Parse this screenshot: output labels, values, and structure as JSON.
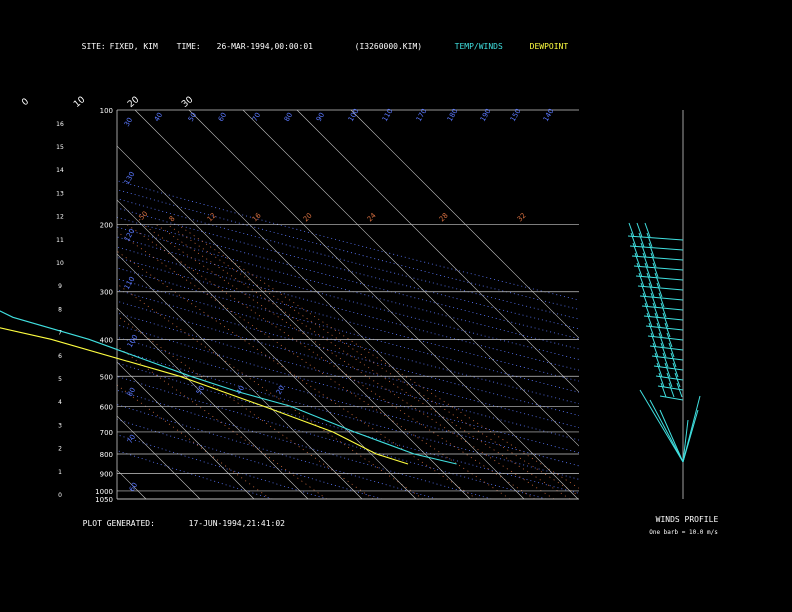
{
  "header": {
    "site_label": "SITE:",
    "site_value": "FIXED, KIM",
    "time_label": "TIME:",
    "time_value": "26-MAR-1994,00:00:01",
    "file_id": "(I3260000.KIM)",
    "temp_legend": "TEMP/WINDS",
    "dew_legend": "DEWPOINT"
  },
  "footer": {
    "generated_label": "PLOT GENERATED:",
    "generated_value": "17-JUN-1994,21:41:02",
    "winds_title": "WINDS PROFILE",
    "barb_note": "One barb = 10.0 m/s"
  },
  "colors": {
    "temperature": "#40e0e0",
    "dewpoint": "#ffff40",
    "isotherm": "#c8c8c8",
    "dry_adiabat": "#5a78ff",
    "mixing_ratio": "#d87040",
    "isobar": "#c8c8c8",
    "winds": "#40e0e0",
    "background": "#000000"
  },
  "chart_data": {
    "type": "line",
    "subtype": "skew-T log-P sounding",
    "y_pressure_ticks": [
      "100",
      "200",
      "300",
      "400",
      "500",
      "600",
      "700",
      "800",
      "900",
      "1000",
      "1050"
    ],
    "y_height_ticks": [
      "0",
      "1",
      "2",
      "3",
      "4",
      "5",
      "6",
      "7",
      "8",
      "9",
      "10",
      "11",
      "12",
      "13",
      "14",
      "15",
      "16"
    ],
    "isotherm_labels": [
      "-110",
      "-100",
      "-90",
      "-80",
      "-70",
      "-60",
      "-50",
      "-40",
      "-30",
      "-20",
      "-10",
      "0",
      "10",
      "20",
      "30"
    ],
    "dry_adiabat_labels": [
      "30",
      "40",
      "50",
      "60",
      "70",
      "80",
      "90",
      "100",
      "110",
      "170",
      "180",
      "190",
      "150",
      "140",
      "130",
      "120",
      "110",
      "100",
      "80",
      "70",
      "60",
      "50",
      "40",
      "20"
    ],
    "mixing_ratio_labels": [
      "-50",
      "8",
      "12",
      "16",
      "20",
      "24",
      "28",
      "32"
    ],
    "series": [
      {
        "name": "TEMP/WINDS",
        "points": [
          {
            "p": 1050,
            "t": null
          },
          {
            "p": 850,
            "t": 14
          },
          {
            "p": 800,
            "t": 8
          },
          {
            "p": 700,
            "t": 1
          },
          {
            "p": 600,
            "t": -6
          },
          {
            "p": 550,
            "t": -13
          },
          {
            "p": 500,
            "t": -19
          },
          {
            "p": 400,
            "t": -31
          },
          {
            "p": 350,
            "t": -41
          },
          {
            "p": 300,
            "t": -46
          },
          {
            "p": 250,
            "t": -52
          },
          {
            "p": 230,
            "t": -51
          },
          {
            "p": 200,
            "t": -48
          }
        ]
      },
      {
        "name": "DEWPOINT",
        "points": [
          {
            "p": 850,
            "t": 5
          },
          {
            "p": 800,
            "t": 1
          },
          {
            "p": 700,
            "t": -3
          },
          {
            "p": 600,
            "t": -11
          },
          {
            "p": 500,
            "t": -21
          },
          {
            "p": 400,
            "t": -38
          },
          {
            "p": 350,
            "t": -52
          },
          {
            "p": 300,
            "t": -67
          },
          {
            "p": 250,
            "t": -80
          },
          {
            "p": 220,
            "t": -75
          },
          {
            "p": 200,
            "t": -70
          }
        ]
      }
    ],
    "wind_profile_barbs": 17
  }
}
